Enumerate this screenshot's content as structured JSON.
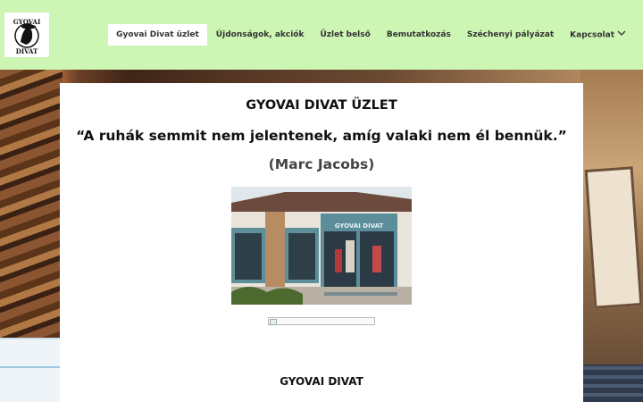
{
  "logo": {
    "text_top": "GYOVAI",
    "text_bottom": "DIVAT"
  },
  "nav": {
    "items": [
      {
        "label": "Gyovai Divat üzlet",
        "active": true
      },
      {
        "label": "Újdonságok, akciók",
        "active": false
      },
      {
        "label": "Üzlet belső",
        "active": false
      },
      {
        "label": "Bemutatkozás",
        "active": false
      },
      {
        "label": "Széchenyi pályázat",
        "active": false
      },
      {
        "label": "Kapcsolat",
        "active": false,
        "has_dropdown": true
      }
    ]
  },
  "main": {
    "title": "GYOVAI DIVAT ÜZLET",
    "quote": "“A ruhák semmit nem jelentenek, amíg valaki nem él bennük.”",
    "author": "(Marc Jacobs)",
    "shop_sign": "GYOVAI DIVAT",
    "subtitle": "GYOVAI DIVAT"
  },
  "colors": {
    "header_bg": "#cdf5b3",
    "card_bg": "#ffffff",
    "text": "#111111",
    "author": "#444444"
  }
}
